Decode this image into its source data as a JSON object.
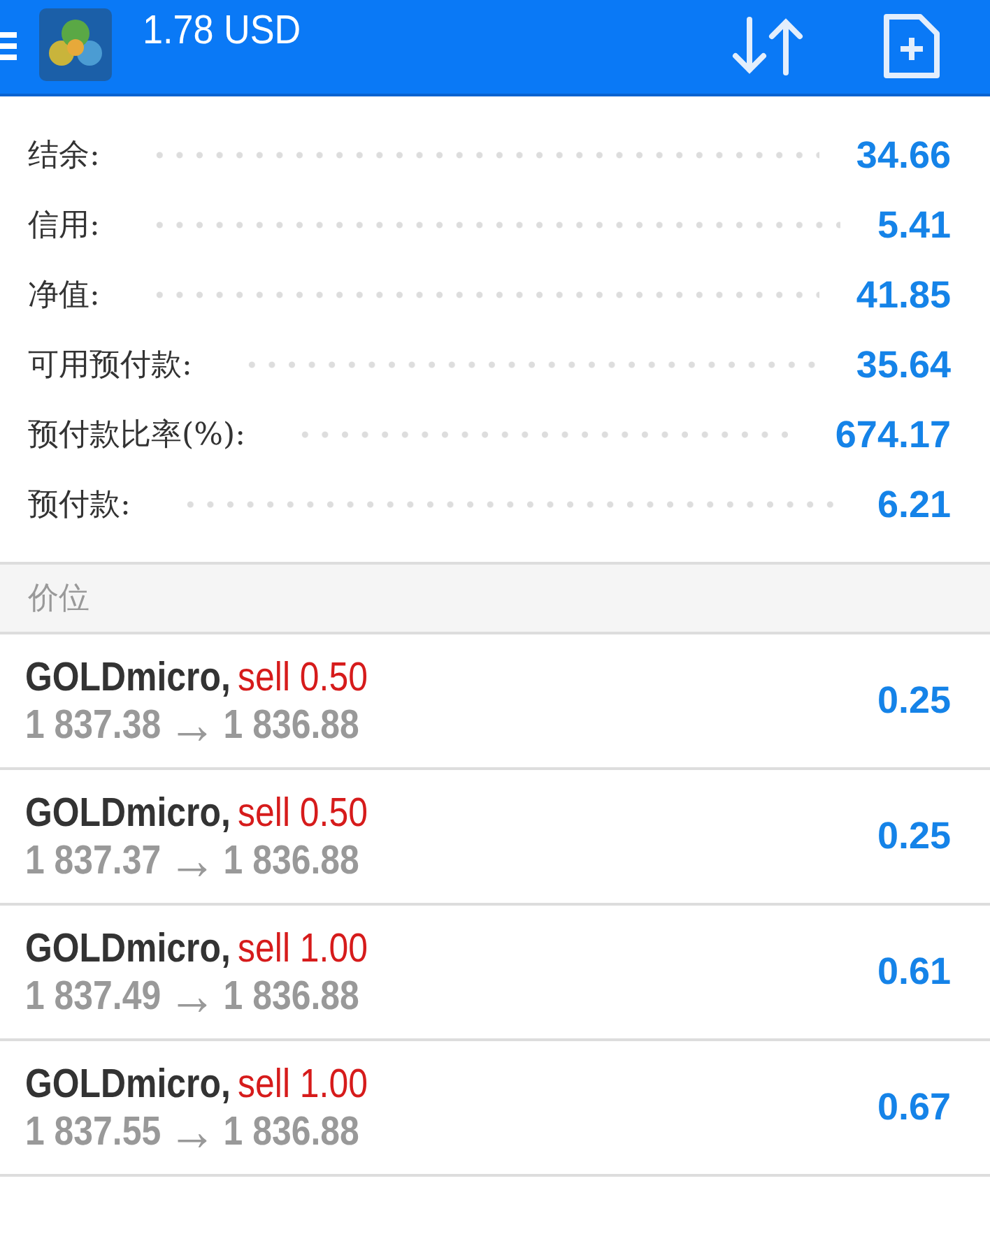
{
  "header": {
    "subtitle": "1.78 USD"
  },
  "summary": [
    {
      "label": "结余:",
      "value": "34.66"
    },
    {
      "label": "信用:",
      "value": "5.41"
    },
    {
      "label": "净值:",
      "value": "41.85"
    },
    {
      "label": "可用预付款:",
      "value": "35.64"
    },
    {
      "label": "预付款比率(%):",
      "value": "674.17"
    },
    {
      "label": "预付款:",
      "value": "6.21"
    }
  ],
  "section": {
    "title": "价位"
  },
  "positions": [
    {
      "symbol": "GOLDmicro,",
      "order": "sell 0.50",
      "open_price": "1 837.38",
      "arrow": "→",
      "current_price": "1 836.88",
      "profit": "0.25"
    },
    {
      "symbol": "GOLDmicro,",
      "order": "sell 0.50",
      "open_price": "1 837.37",
      "arrow": "→",
      "current_price": "1 836.88",
      "profit": "0.25"
    },
    {
      "symbol": "GOLDmicro,",
      "order": "sell 1.00",
      "open_price": "1 837.49",
      "arrow": "→",
      "current_price": "1 836.88",
      "profit": "0.61"
    },
    {
      "symbol": "GOLDmicro,",
      "order": "sell 1.00",
      "open_price": "1 837.55",
      "arrow": "→",
      "current_price": "1 836.88",
      "profit": "0.67"
    }
  ]
}
